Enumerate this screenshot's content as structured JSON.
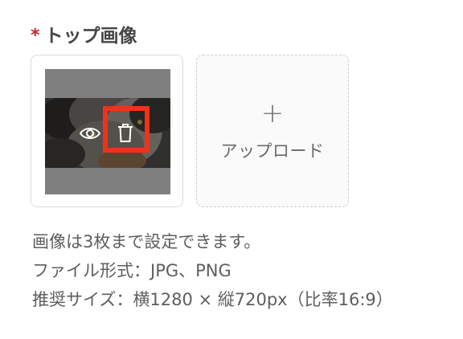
{
  "field": {
    "required_mark": "*",
    "label": "トップ画像"
  },
  "thumbnail": {
    "image_alt": "cat photo",
    "actions": [
      {
        "name": "preview",
        "icon": "eye-icon"
      },
      {
        "name": "delete",
        "icon": "trash-icon"
      }
    ]
  },
  "upload": {
    "plus": "+",
    "label": "アップロード"
  },
  "notes": [
    "画像は3枚まで設定できます。",
    "ファイル形式：JPG、PNG",
    "推奨サイズ：横1280 × 縦720px（比率16:9）"
  ],
  "colors": {
    "required": "#d3242a",
    "highlight": "#f0321a",
    "text": "#5e5e5e"
  }
}
